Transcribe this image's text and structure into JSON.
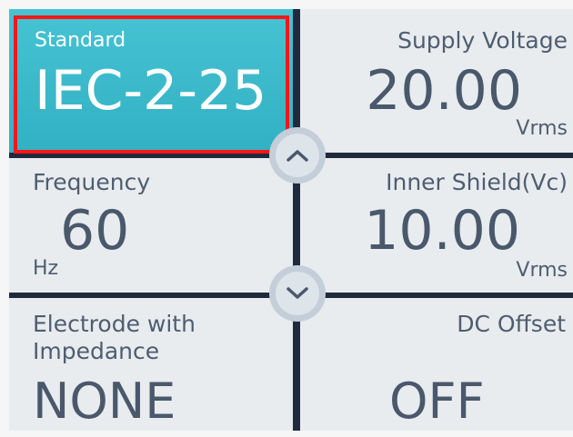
{
  "tiles": {
    "standard": {
      "label": "Standard",
      "value": "IEC-2-25",
      "unit": ""
    },
    "supply": {
      "label": "Supply Voltage",
      "value": "20.00",
      "unit": "Vrms"
    },
    "frequency": {
      "label": "Frequency",
      "value": "60",
      "unit": "Hz"
    },
    "inner": {
      "label": "Inner Shield(Vc)",
      "value": "10.00",
      "unit": "Vrms"
    },
    "electrode": {
      "label_line1": "Electrode with",
      "label_line2": "Impedance",
      "value": "NONE"
    },
    "dc": {
      "label": "DC Offset",
      "value": "OFF"
    }
  },
  "nav": {
    "up_icon": "chevron-up-icon",
    "down_icon": "chevron-down-icon"
  },
  "colors": {
    "active_tile": "#3fbccd",
    "tile_bg": "#e8ecef",
    "selection_border": "#ff1616",
    "text": "#4a586b"
  }
}
